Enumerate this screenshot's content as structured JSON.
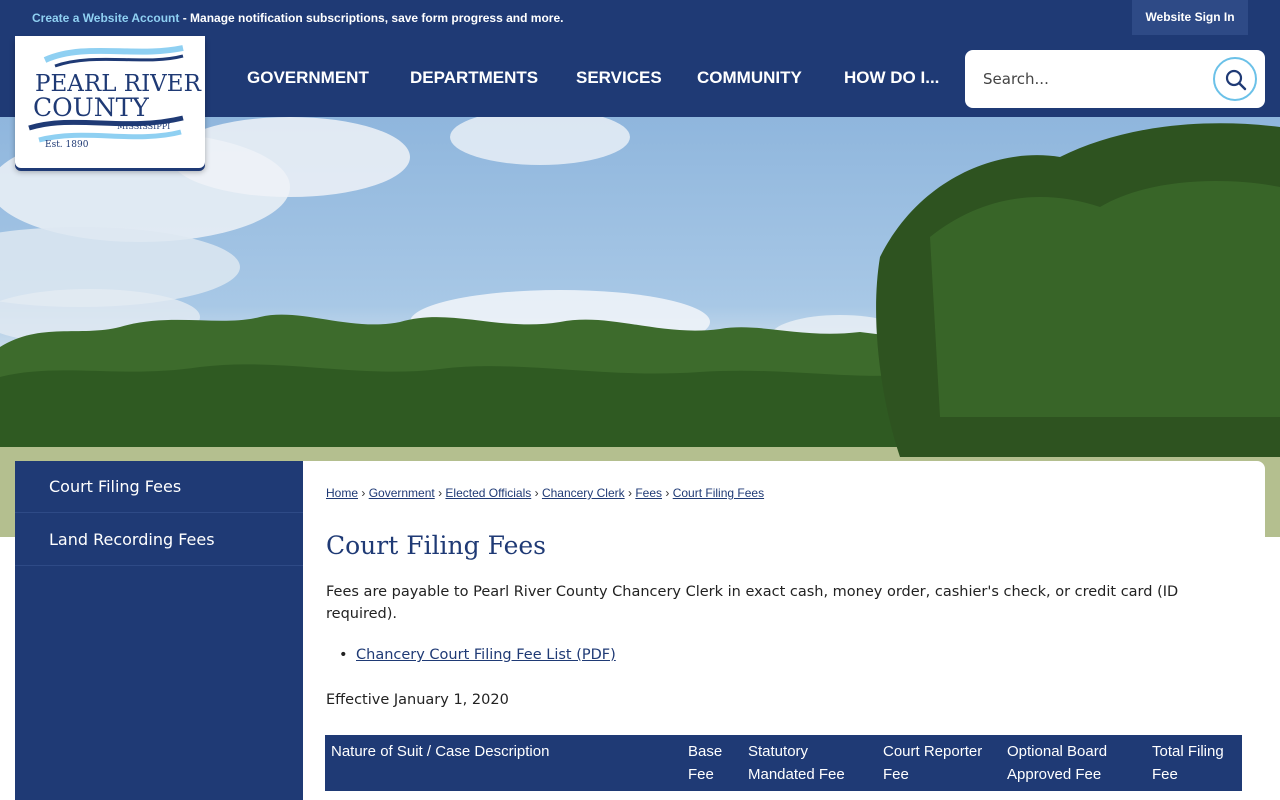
{
  "topbar": {
    "create_account_link": "Create a Website Account",
    "create_account_rest": " - Manage notification subscriptions, save form progress and more.",
    "sign_in": "Website Sign In"
  },
  "logo": {
    "line1": "PEARL RIVER",
    "line2": "COUNTY",
    "state": "MISSISSIPPI",
    "est": "Est. 1890"
  },
  "nav": {
    "items": [
      "GOVERNMENT",
      "DEPARTMENTS",
      "SERVICES",
      "COMMUNITY",
      "HOW DO I..."
    ]
  },
  "search": {
    "placeholder": "Search..."
  },
  "sidebar": {
    "items": [
      "Court Filing Fees",
      "Land Recording Fees"
    ]
  },
  "breadcrumb": {
    "items": [
      "Home",
      "Government",
      "Elected Officials",
      "Chancery Clerk",
      "Fees",
      "Court Filing Fees"
    ],
    "separator": "›"
  },
  "content": {
    "title": "Court Filing Fees",
    "intro": "Fees are payable to Pearl River County Chancery Clerk in exact cash, money order, cashier's check, or credit card (ID required).",
    "doc_link": "Chancery Court Filing Fee List (PDF)",
    "effective": "Effective January 1, 2020"
  },
  "table": {
    "headers": [
      "Nature of Suit / Case Description",
      "Base Fee",
      "Statutory Mandated Fee",
      "Court Reporter Fee",
      "Optional Board Approved Fee",
      "Total Filing Fee"
    ]
  },
  "colors": {
    "brand_navy": "#1f3a75",
    "accent_light_blue": "#8fd0f2",
    "search_ring": "#6bc1e8"
  }
}
